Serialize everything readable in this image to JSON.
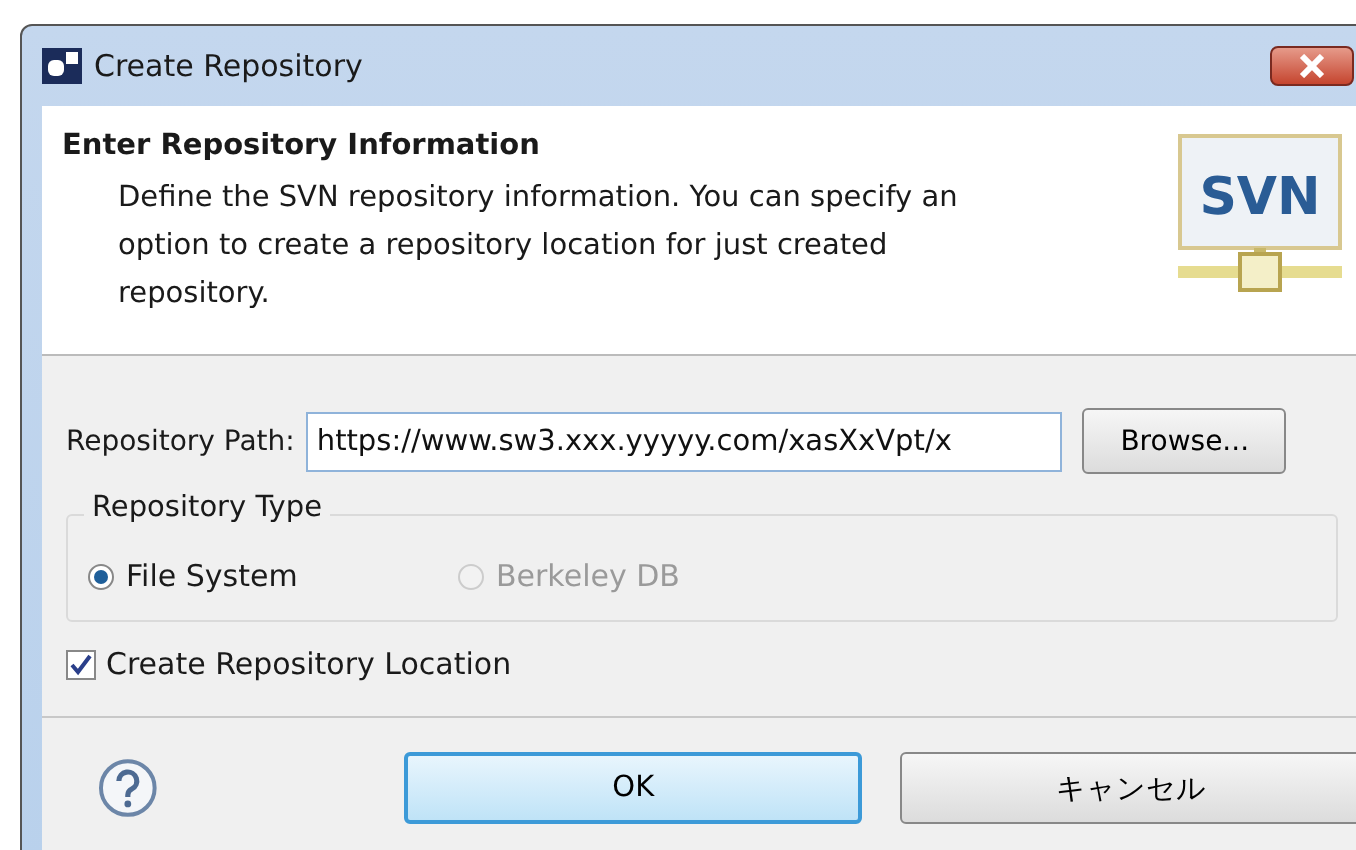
{
  "window": {
    "title": "Create Repository"
  },
  "header": {
    "title": "Enter Repository Information",
    "description": "Define the SVN repository information. You can specify an option to create a repository location for just created repository.",
    "logo_text": "SVN"
  },
  "path": {
    "label": "Repository Path:",
    "value": "https://www.sw3.xxx.yyyyy.com/xasXxVpt/x",
    "browse": "Browse..."
  },
  "repository_type": {
    "title": "Repository Type",
    "options": [
      {
        "label": "File System",
        "selected": true,
        "disabled": false
      },
      {
        "label": "Berkeley DB",
        "selected": false,
        "disabled": true
      }
    ]
  },
  "create_location": {
    "label": "Create Repository Location",
    "checked": true
  },
  "buttons": [
    {
      "label": "OK",
      "default": true
    },
    {
      "label": "キャンセル",
      "default": false
    }
  ]
}
